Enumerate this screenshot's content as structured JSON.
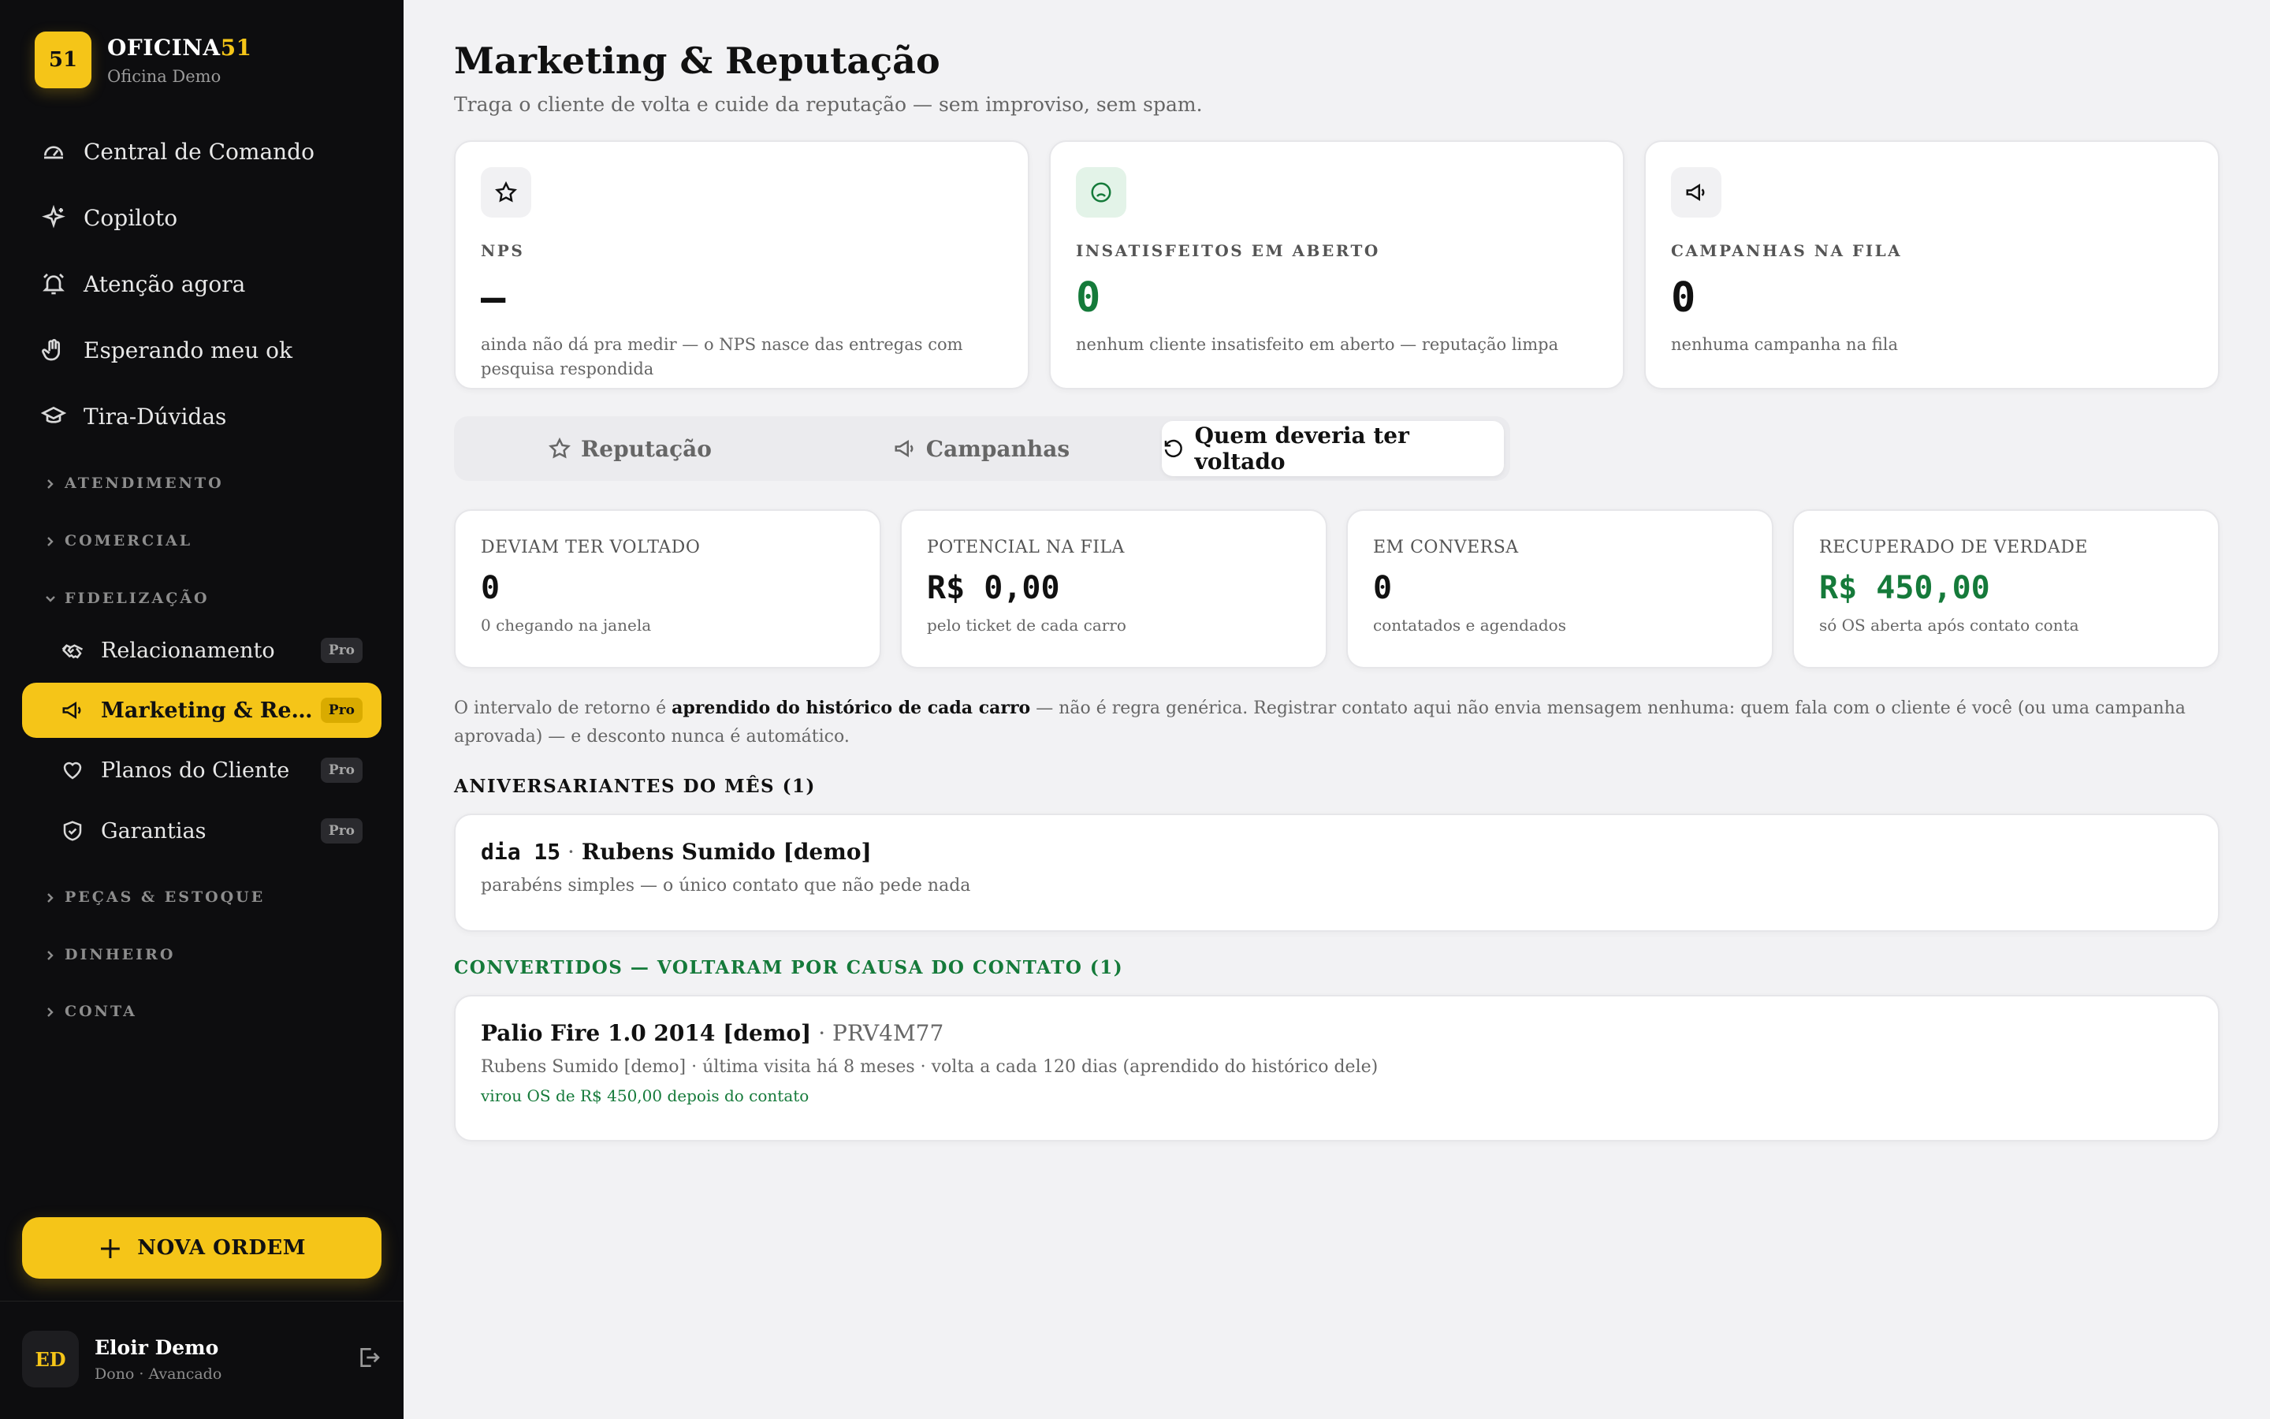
{
  "brand": {
    "logo_text": "51",
    "name_main": "OFICINA",
    "name_accent": "51",
    "subtitle": "Oficina Demo"
  },
  "sidebar": {
    "nav": [
      {
        "label": "Central de Comando",
        "icon": "gauge-icon"
      },
      {
        "label": "Copiloto",
        "icon": "sparkle-icon"
      },
      {
        "label": "Atenção agora",
        "icon": "alarm-icon"
      },
      {
        "label": "Esperando meu ok",
        "icon": "hand-icon"
      },
      {
        "label": "Tira-Dúvidas",
        "icon": "graduation-cap-icon"
      }
    ],
    "sections": {
      "atendimento": "ATENDIMENTO",
      "comercial": "COMERCIAL",
      "fidelizacao": "FIDELIZAÇÃO",
      "pecas": "PEÇAS & ESTOQUE",
      "dinheiro": "DINHEIRO",
      "conta": "CONTA"
    },
    "fidelizacao_items": [
      {
        "label": "Relacionamento",
        "badge": "Pro",
        "icon": "handshake-icon"
      },
      {
        "label": "Marketing & Reputação",
        "badge": "Pro",
        "icon": "megaphone-icon",
        "active": true
      },
      {
        "label": "Planos do Cliente",
        "badge": "Pro",
        "icon": "heart-icon"
      },
      {
        "label": "Garantias",
        "badge": "Pro",
        "icon": "shield-check-icon"
      }
    ],
    "new_order": "NOVA ORDEM",
    "user": {
      "initials": "ED",
      "name": "Eloir Demo",
      "role": "Dono · Avancado"
    }
  },
  "page": {
    "title": "Marketing & Reputação",
    "subtitle": "Traga o cliente de volta e cuide da reputação — sem improviso, sem spam."
  },
  "kpis": [
    {
      "label": "NPS",
      "value": "—",
      "note": "ainda não dá pra medir — o NPS nasce das entregas com pesquisa respondida",
      "icon": "star-icon"
    },
    {
      "label": "INSATISFEITOS EM ABERTO",
      "value": "0",
      "note": "nenhum cliente insatisfeito em aberto — reputação limpa",
      "icon": "frown-icon"
    },
    {
      "label": "CAMPANHAS NA FILA",
      "value": "0",
      "note": "nenhuma campanha na fila",
      "icon": "megaphone-icon"
    }
  ],
  "tabs": [
    {
      "label": "Reputação",
      "icon": "star-icon"
    },
    {
      "label": "Campanhas",
      "icon": "megaphone-icon"
    },
    {
      "label": "Quem deveria ter voltado",
      "icon": "rotate-ccw-icon",
      "active": true
    }
  ],
  "stats": [
    {
      "label": "DEVIAM TER VOLTADO",
      "value": "0",
      "note": "0 chegando na janela"
    },
    {
      "label": "POTENCIAL NA FILA",
      "value": "R$ 0,00",
      "note": "pelo ticket de cada carro"
    },
    {
      "label": "EM CONVERSA",
      "value": "0",
      "note": "contatados e agendados"
    },
    {
      "label": "RECUPERADO DE VERDADE",
      "value": "R$ 450,00",
      "note": "só OS aberta após contato conta"
    }
  ],
  "explain": {
    "before": "O intervalo de retorno é ",
    "bold": "aprendido do histórico de cada carro",
    "after": " — não é regra genérica. Registrar contato aqui não envia mensagem nenhuma: quem fala com o cliente é você (ou uma campanha aprovada) — e desconto nunca é automático."
  },
  "birthdays": {
    "heading": "ANIVERSARIANTES DO MÊS (1)",
    "item": {
      "day": "dia 15",
      "sep": " · ",
      "name": "Rubens Sumido [demo]",
      "note": "parabéns simples — o único contato que não pede nada"
    }
  },
  "converted": {
    "heading": "CONVERTIDOS — VOLTARAM POR CAUSA DO CONTATO (1)",
    "item": {
      "car": "Palio Fire 1.0 2014 [demo]",
      "plate": " · PRV4M77",
      "details": "Rubens Sumido [demo] · última visita há 8 meses · volta a cada 120 dias (aprendido do histórico dele)",
      "result": "virou OS de R$ 450,00 depois do contato"
    }
  },
  "colors": {
    "accent": "#f5c518",
    "sidebar_bg": "#0d0d0f",
    "positive": "#157a3a",
    "page_bg": "#f2f2f4"
  }
}
